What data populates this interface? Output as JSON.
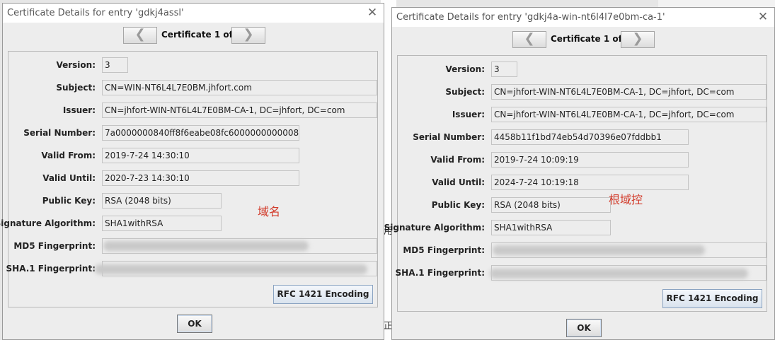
{
  "background": {
    "marks": [
      "用",
      "正"
    ]
  },
  "dialogs": [
    {
      "title": "Certificate Details for entry 'gdkj4assl'",
      "close_glyph": "✕",
      "prev_glyph": "❮",
      "next_glyph": "❯",
      "nav_label": "Certificate 1 of 1",
      "labels": {
        "version": "Version:",
        "subject": "Subject:",
        "issuer": "Issuer:",
        "serial": "Serial Number:",
        "valid_from": "Valid From:",
        "valid_until": "Valid Until:",
        "public_key": "Public Key:",
        "sig_alg": "Signature Algorithm:",
        "md5": "MD5 Fingerprint:",
        "sha1": "SHA.1 Fingerprint:"
      },
      "values": {
        "version": "3",
        "subject": "CN=WIN-NT6L4L7E0BM.jhfort.com",
        "issuer": "CN=jhfort-WIN-NT6L4L7E0BM-CA-1, DC=jhfort, DC=com",
        "serial": "7a0000000840ff8f6eabe08fc6000000000008",
        "valid_from": "2019-7-24 14:30:10",
        "valid_until": "2020-7-23 14:30:10",
        "public_key": "RSA (2048 bits)",
        "sig_alg": "SHA1withRSA",
        "md5": "",
        "sha1": ""
      },
      "rfc_button": "RFC 1421 Encoding",
      "ok_button": "OK",
      "annotation": "域名"
    },
    {
      "title": "Certificate Details for entry 'gdkj4a-win-nt6l4l7e0bm-ca-1'",
      "close_glyph": "✕",
      "prev_glyph": "❮",
      "next_glyph": "❯",
      "nav_label": "Certificate 1 of 1",
      "labels": {
        "version": "Version:",
        "subject": "Subject:",
        "issuer": "Issuer:",
        "serial": "Serial Number:",
        "valid_from": "Valid From:",
        "valid_until": "Valid Until:",
        "public_key": "Public Key:",
        "sig_alg": "Signature Algorithm:",
        "md5": "MD5 Fingerprint:",
        "sha1": "SHA.1 Fingerprint:"
      },
      "values": {
        "version": "3",
        "subject": "CN=jhfort-WIN-NT6L4L7E0BM-CA-1, DC=jhfort, DC=com",
        "issuer": "CN=jhfort-WIN-NT6L4L7E0BM-CA-1, DC=jhfort, DC=com",
        "serial": "4458b11f1bd74eb54d70396e07fddbb1",
        "valid_from": "2019-7-24 10:09:19",
        "valid_until": "2024-7-24 10:19:18",
        "public_key": "RSA (2048 bits)",
        "sig_alg": "SHA1withRSA",
        "md5": "",
        "sha1": ""
      },
      "rfc_button": "RFC 1421 Encoding",
      "ok_button": "OK",
      "annotation": "根域控"
    }
  ]
}
